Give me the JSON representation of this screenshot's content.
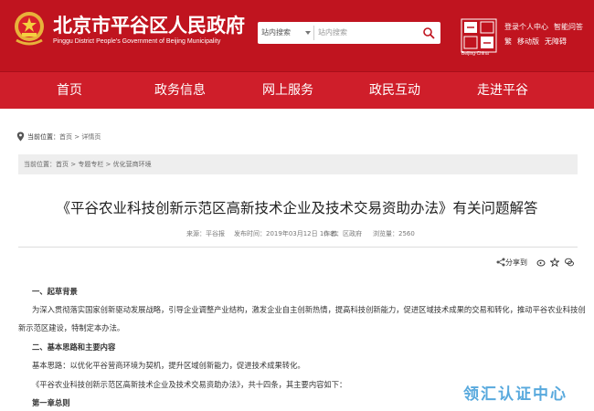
{
  "header": {
    "site_title": "北京市平谷区人民政府",
    "site_subtitle": "Pinggu District People's Government of Beijing Municipality",
    "search_scope": "站内搜索",
    "search_placeholder": "站内搜索",
    "logo_subtitle": "Beijing·China",
    "user_links_row1": [
      "登录个人中心",
      "智能问答"
    ],
    "user_links_row2": [
      "繁",
      "移动版",
      "无障碍"
    ]
  },
  "nav": {
    "items": [
      "首页",
      "政务信息",
      "网上服务",
      "政民互动",
      "走进平谷"
    ]
  },
  "breadcrumb_top": {
    "label": "当前位置：",
    "path": [
      "首页",
      "详情页"
    ]
  },
  "breadcrumb_bar": {
    "label": "当前位置：",
    "path": [
      "首页",
      "专题专栏",
      "优化营商环境"
    ]
  },
  "article": {
    "title": "《平谷农业科技创新示范区高新技术企业及技术交易资助办法》有关问题解答",
    "meta": {
      "source": "来源：平谷报",
      "date": "发布时间：2019年03月12日 10:31",
      "author": "作者：区政府",
      "views": "浏览量：2560"
    },
    "share_label": "分享到",
    "paragraphs": [
      "一、起草背景",
      "为深入贯彻落实国家创新驱动发展战略，引导企业调整产业结构，激发企业自主创新热情，提高科技创新能力，促进区域技术成果的交易和转化，推动平谷农业科技创",
      "新示范区建设，特制定本办法。",
      "二、基本思路和主要内容",
      "基本思路：以优化平谷营商环境为契机，提升区域创新能力，促进技术成果转化。",
      "《平谷农业科技创新示范区高新技术企业及技术交易资助办法》，共十四条，其主要内容如下：",
      "第一章总则"
    ]
  },
  "watermark": "领汇认证中心",
  "colors": {
    "header_red": "#c0141f",
    "nav_red": "#cf1e2a",
    "watermark_blue": "#3b9bd8"
  }
}
